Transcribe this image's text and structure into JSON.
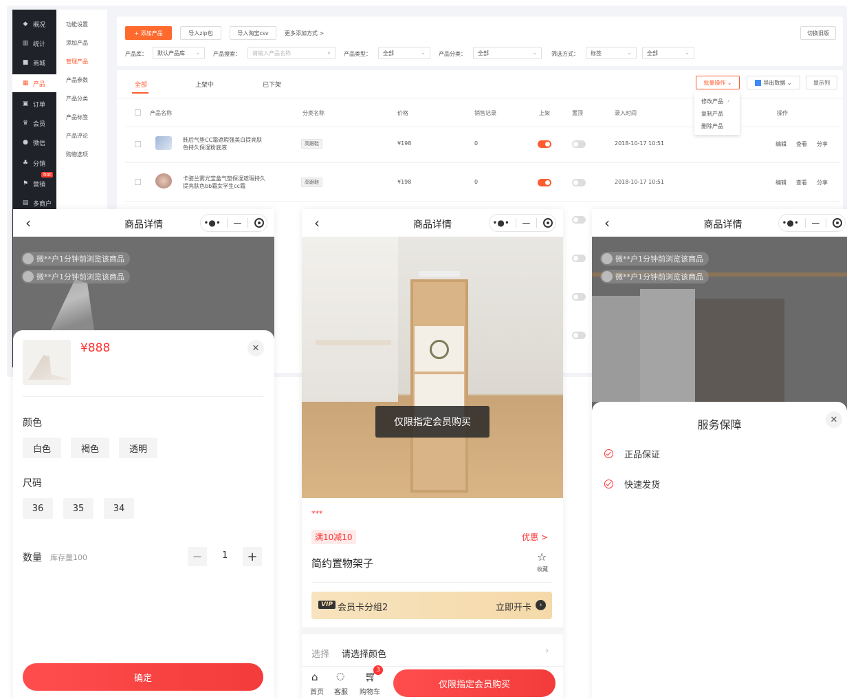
{
  "admin": {
    "main_nav": [
      {
        "label": "概况",
        "icon": "dashboard-icon"
      },
      {
        "label": "统计",
        "icon": "chart-icon"
      },
      {
        "label": "商城",
        "icon": "store-icon"
      },
      {
        "label": "产品",
        "icon": "grid-icon",
        "active": true
      },
      {
        "label": "订单",
        "icon": "order-icon"
      },
      {
        "label": "会员",
        "icon": "crown-icon"
      },
      {
        "label": "微信",
        "icon": "wechat-icon"
      },
      {
        "label": "分销",
        "icon": "share-icon"
      },
      {
        "label": "营销",
        "icon": "flag-icon"
      },
      {
        "label": "多商户",
        "icon": "shop-icon"
      }
    ],
    "hot_badge": "hot",
    "sub_nav": [
      "功能设置",
      "添加产品",
      "管理产品",
      "产品参数",
      "产品分类",
      "产品标签",
      "产品评论",
      "购物选项"
    ],
    "sub_nav_active": "管理产品",
    "toolbar": {
      "add_product": "+ 添加产品",
      "import_zip": "导入zip包",
      "import_taobao": "导入淘宝csv",
      "more_ways": "更多添加方式 >",
      "switch_old": "切换旧版"
    },
    "filters": {
      "library_label": "产品库：",
      "library_value": "默认产品库",
      "search_label": "产品搜索：",
      "search_placeholder": "请输入产品名称",
      "type_label": "产品类型：",
      "type_value": "全部",
      "category_label": "产品分类：",
      "category_value": "全部",
      "filter_label": "筛选方式：",
      "filter_value": "标签",
      "filter_value2": "全部"
    },
    "tabs": [
      "全部",
      "上架中",
      "已下架"
    ],
    "actions": {
      "batch": "批量操作",
      "export": "导出数据",
      "columns": "显示列"
    },
    "batch_menu": [
      "修改产品",
      "复制产品",
      "删除产品"
    ],
    "columns": [
      "产品名称",
      "分类名称",
      "价格",
      "销售记录",
      "上架",
      "置顶",
      "录入时间",
      "操作"
    ],
    "rows": [
      {
        "name": "韩后气垫CC霜遮瑕强美白提亮肤色持久保湿粉底液",
        "category": "高跟鞋",
        "price": "¥198",
        "sales": "0",
        "time": "2018-10-17 10:51",
        "ops": [
          "编辑",
          "查看",
          "分享"
        ]
      },
      {
        "name": "卡姿兰雾光宝盒气垫保湿遮瑕持久提亮肤色bb霜女学生cc霜",
        "category": "高跟鞋",
        "price": "¥198",
        "sales": "0",
        "time": "2018-10-17 10:51",
        "ops": [
          "编辑",
          "查看",
          "分享"
        ]
      }
    ]
  },
  "phones": {
    "title": "商品详情",
    "capsule_dots": "•●•",
    "capsule_minus": "—",
    "toast": "微**户1分钟前浏览该商品",
    "left": {
      "price": "¥888",
      "color_label": "颜色",
      "colors": [
        "白色",
        "褐色",
        "透明"
      ],
      "size_label": "尺码",
      "sizes": [
        "36",
        "35",
        "34"
      ],
      "qty_label": "数量",
      "stock": "库存量100",
      "qty": "1",
      "confirm": "确定"
    },
    "middle": {
      "overlay": "仅限指定会员购买",
      "stars": "***",
      "promo_tag": "满10减10",
      "promo_link": "优惠 >",
      "product_name": "简约置物架子",
      "fav": "收藏",
      "vip_badge": "VIP",
      "vip_group": "会员卡分组2",
      "vip_action": "立即开卡",
      "select_label": "选择",
      "select_value": "请选择颜色",
      "nav_home": "首页",
      "nav_service": "客服",
      "nav_cart": "购物车",
      "cart_count": "3",
      "buy_button": "仅限指定会员购买"
    },
    "right": {
      "sheet_title": "服务保障",
      "items": [
        "正品保证",
        "快速发货"
      ]
    }
  }
}
